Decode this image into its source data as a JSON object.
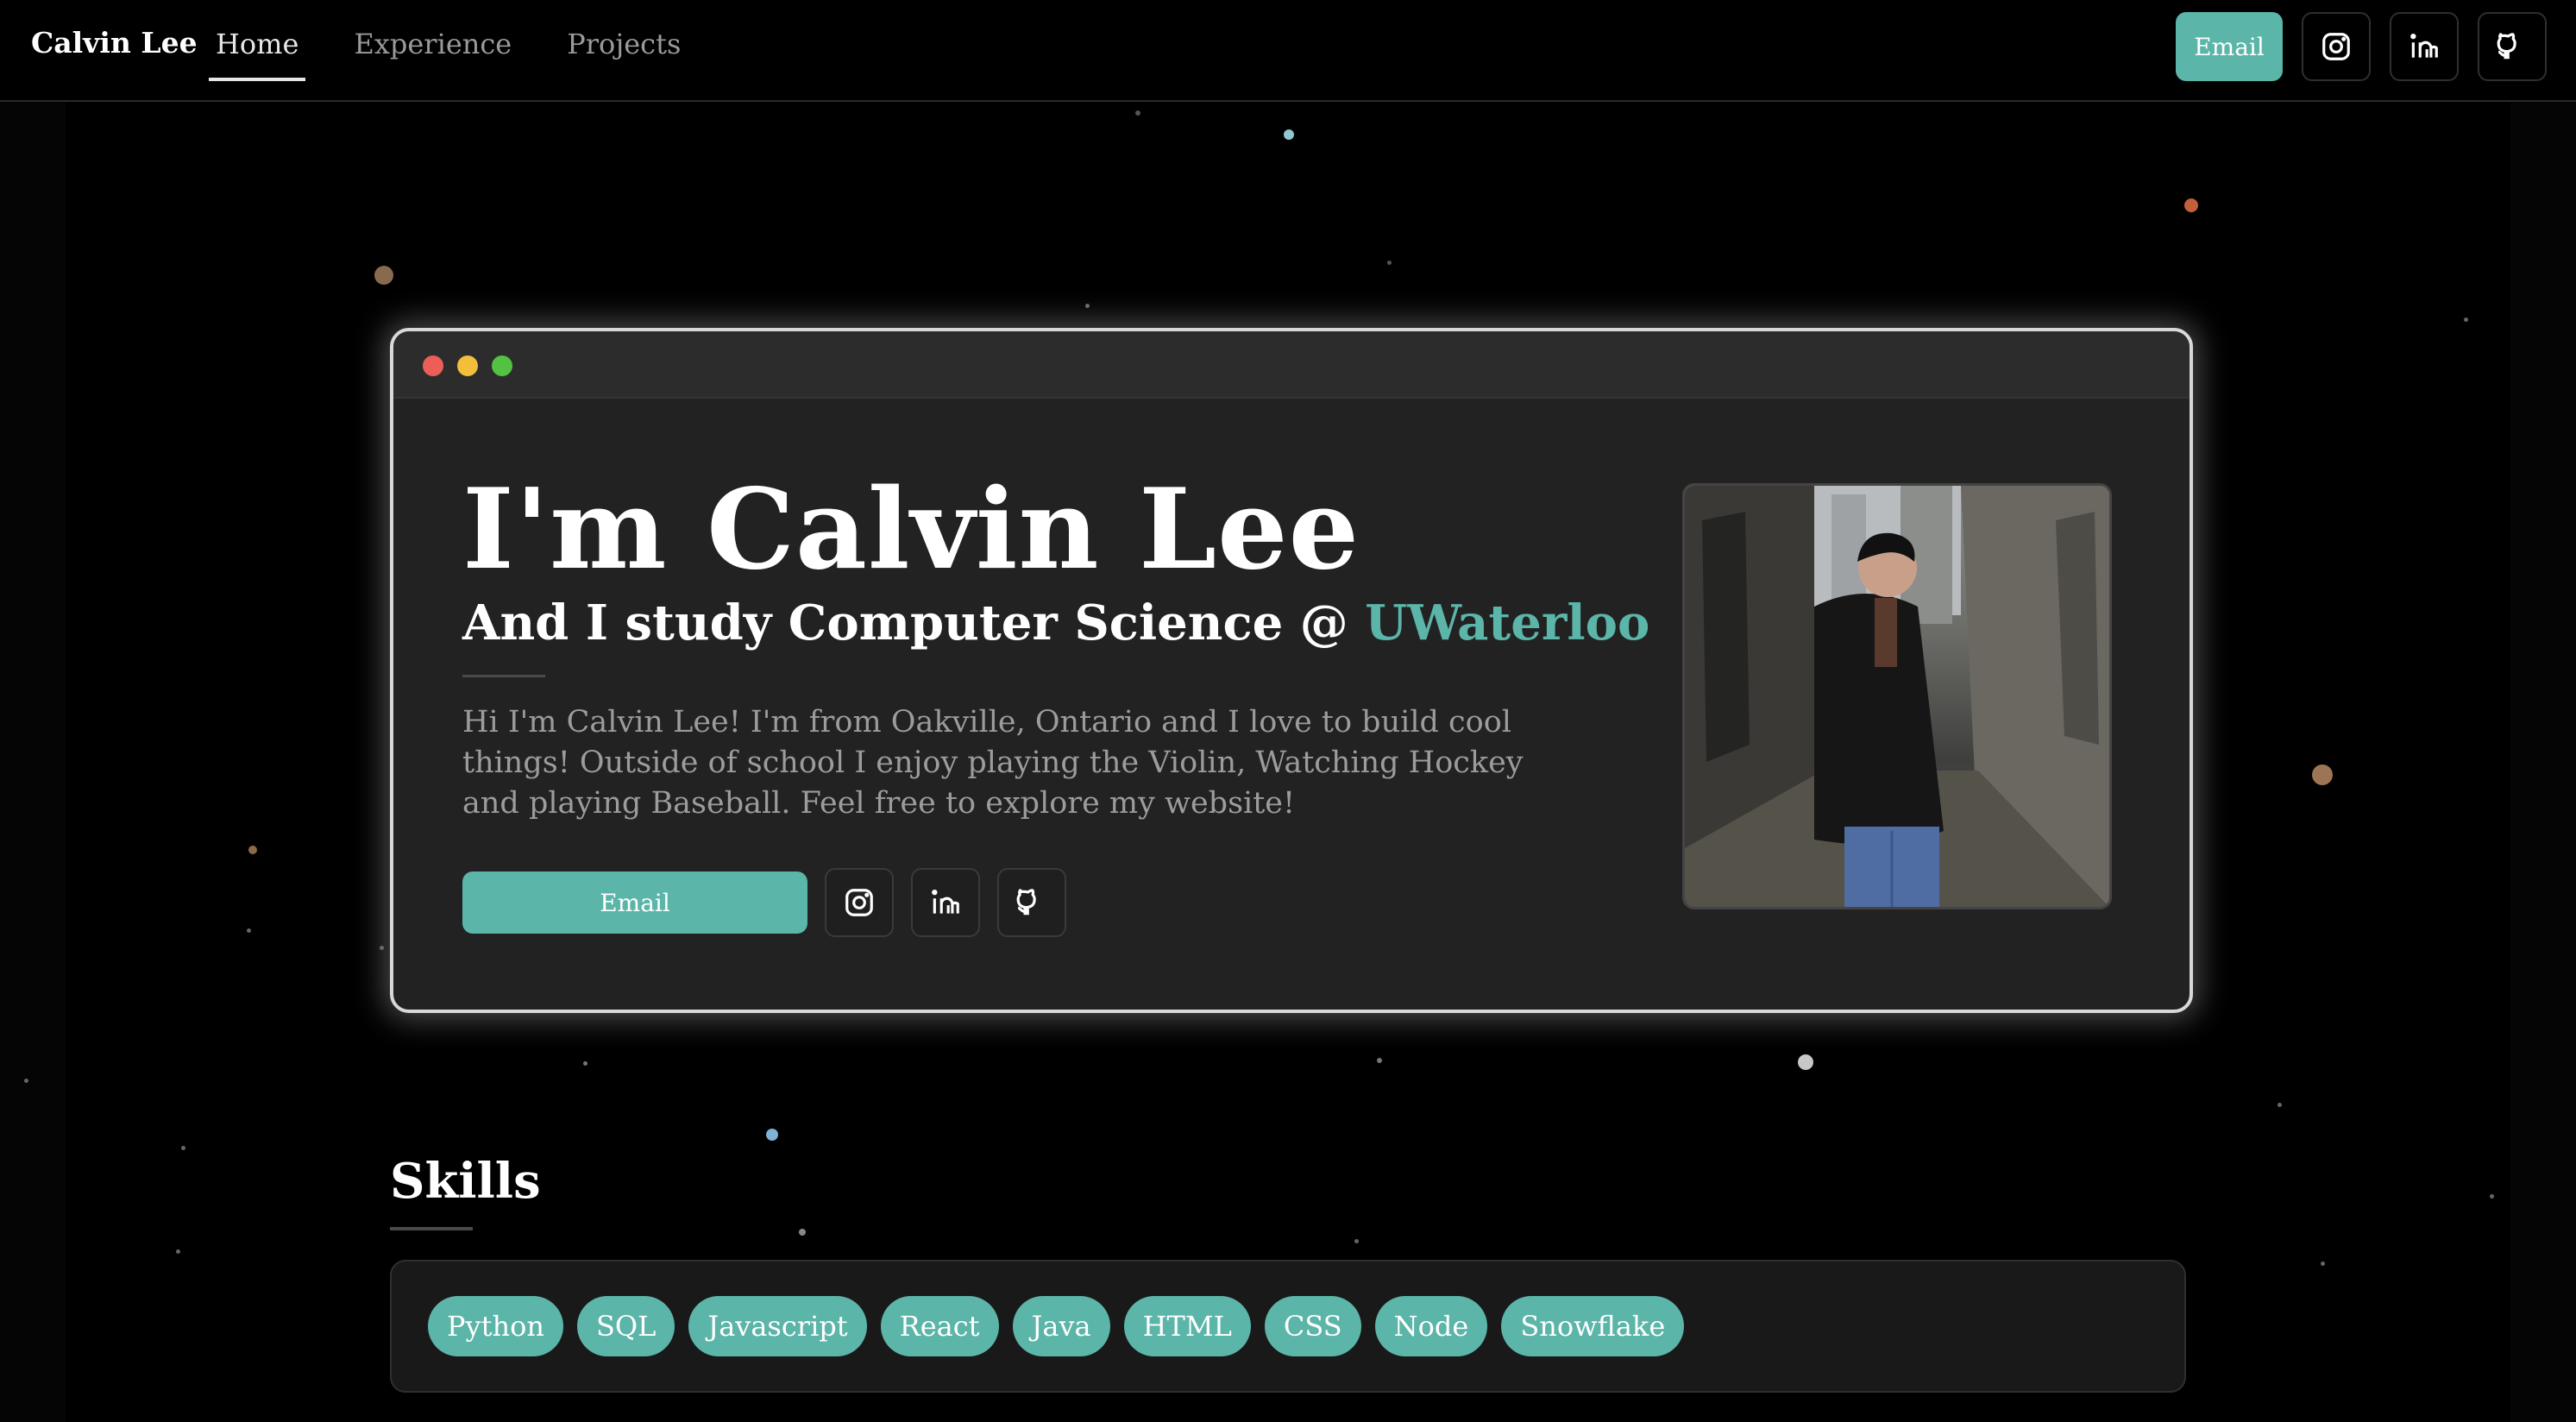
{
  "nav": {
    "brand": "Calvin Lee",
    "links": [
      {
        "label": "Home",
        "active": true
      },
      {
        "label": "Experience",
        "active": false
      },
      {
        "label": "Projects",
        "active": false
      }
    ],
    "email_label": "Email",
    "icons": [
      "instagram-icon",
      "linkedin-icon",
      "github-icon"
    ]
  },
  "hero": {
    "title": "I'm Calvin Lee",
    "subtitle_prefix": "And I study Computer Science @ ",
    "subtitle_accent": "UWaterloo",
    "description": "Hi I'm Calvin Lee! I'm from Oakville, Ontario and I love to build cool things! Outside of school I enjoy playing the Violin, Watching Hockey and playing Baseball. Feel free to explore my website!",
    "email_label": "Email",
    "icons": [
      "instagram-icon",
      "linkedin-icon",
      "github-icon"
    ]
  },
  "skills": {
    "title": "Skills",
    "items": [
      "Python",
      "SQL",
      "Javascript",
      "React",
      "Java",
      "HTML",
      "CSS",
      "Node",
      "Snowflake"
    ]
  },
  "colors": {
    "accent": "#5bb5a8",
    "background": "#000000",
    "card": "#222222"
  }
}
